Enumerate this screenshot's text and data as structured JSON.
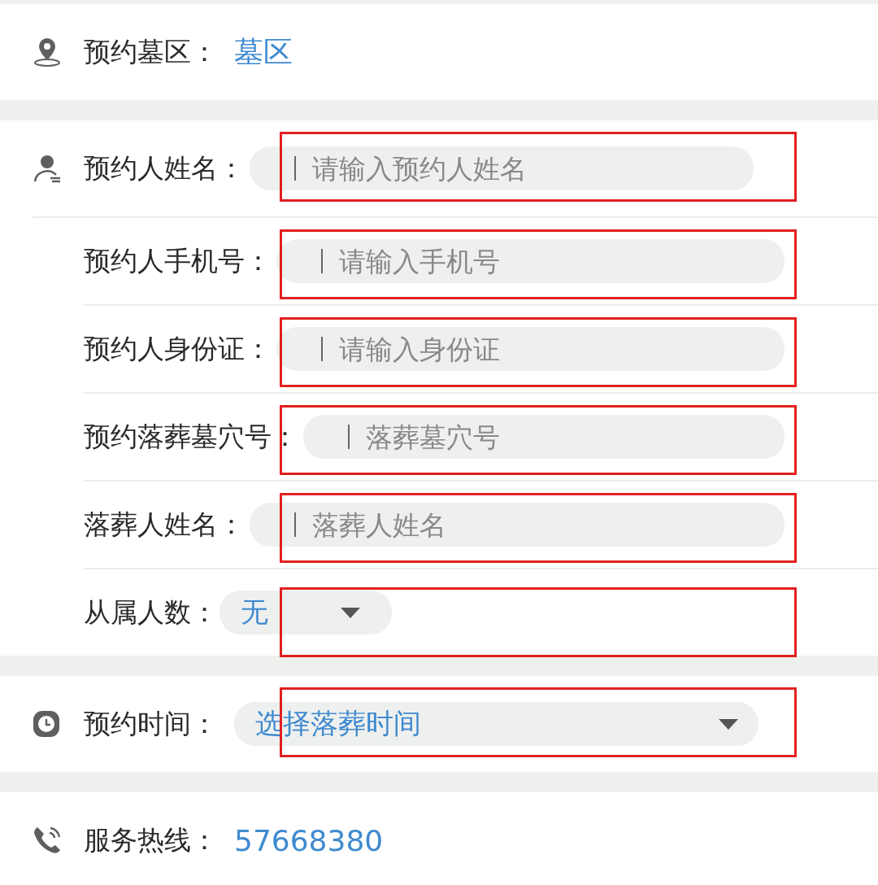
{
  "sections": [
    {
      "rows": [
        {
          "kind": "value",
          "label": "预约墓区：",
          "value": "墓区",
          "highlighted": false
        }
      ]
    },
    {
      "rows": [
        {
          "kind": "input",
          "label": "预约人姓名：",
          "placeholder": "请输入预约人姓名",
          "highlighted": true
        },
        {
          "kind": "input",
          "label": "预约人手机号：",
          "placeholder": "请输入手机号",
          "highlighted": true
        },
        {
          "kind": "input",
          "label": "预约人身份证：",
          "placeholder": "请输入身份证",
          "highlighted": true
        },
        {
          "kind": "input",
          "label": "预约落葬墓穴号：",
          "placeholder": "落葬墓穴号",
          "highlighted": true
        },
        {
          "kind": "input",
          "label": "落葬人姓名：",
          "placeholder": "落葬人姓名",
          "highlighted": true
        },
        {
          "kind": "select",
          "label": "从属人数：",
          "value": "无",
          "highlighted": true
        }
      ]
    },
    {
      "rows": [
        {
          "kind": "picker",
          "label": "预约时间：",
          "value": "选择落葬时间",
          "highlighted": true
        }
      ]
    },
    {
      "rows": [
        {
          "kind": "value",
          "label": "服务热线：",
          "value": "57668380",
          "highlighted": false
        }
      ]
    }
  ]
}
